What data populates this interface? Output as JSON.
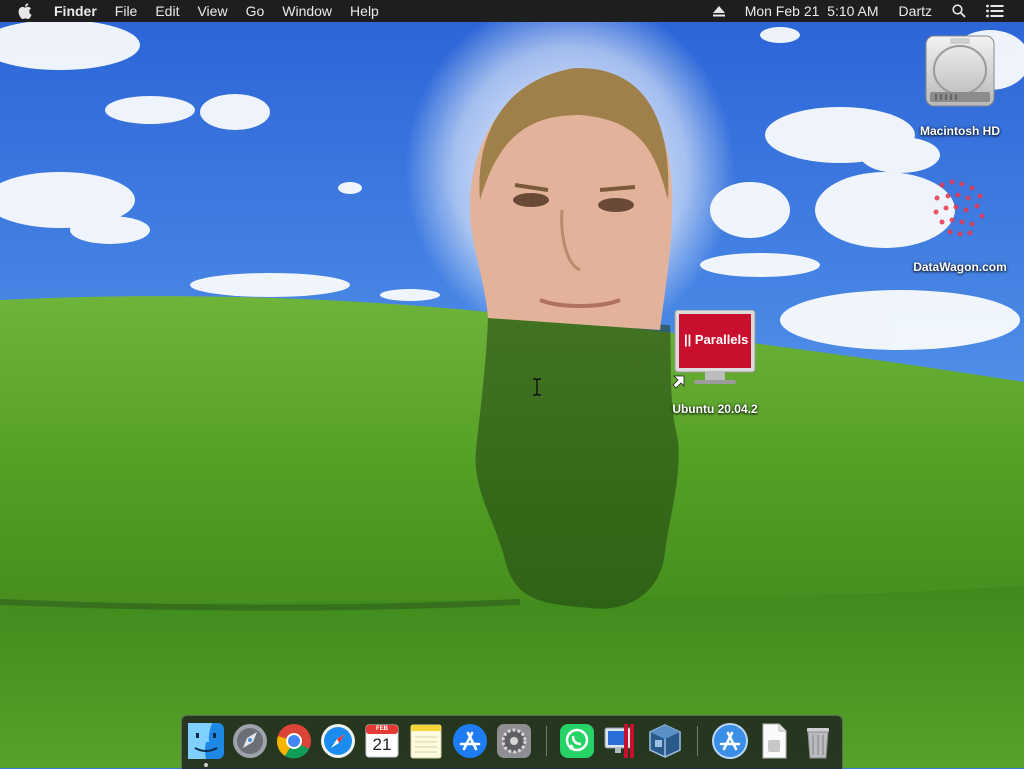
{
  "menubar": {
    "app_name": "Finder",
    "menus": [
      "File",
      "Edit",
      "View",
      "Go",
      "Window",
      "Help"
    ],
    "datetime": "Mon Feb 21  5:10 AM",
    "user": "Dartz"
  },
  "desktop": {
    "icons": [
      {
        "label": "Macintosh HD",
        "icon": "hard-drive-icon"
      },
      {
        "label": "DataWagon.com",
        "icon": "datawagon-icon"
      },
      {
        "label": "Ubuntu 20.04.2",
        "icon": "parallels-vm-icon"
      }
    ],
    "parallels_logo_text": "|| Parallels"
  },
  "dock": {
    "items": [
      {
        "name": "finder",
        "icon": "finder-icon",
        "running": true
      },
      {
        "name": "launchpad",
        "icon": "launchpad-icon"
      },
      {
        "name": "chrome",
        "icon": "chrome-icon"
      },
      {
        "name": "safari",
        "icon": "safari-icon"
      },
      {
        "name": "calendar",
        "icon": "calendar-icon"
      },
      {
        "name": "notes",
        "icon": "notes-icon"
      },
      {
        "name": "app-store",
        "icon": "app-store-icon"
      },
      {
        "name": "system-preferences",
        "icon": "gear-icon"
      },
      {
        "name": "whatsapp",
        "icon": "whatsapp-icon"
      },
      {
        "name": "parallels-desktop",
        "icon": "parallels-icon"
      },
      {
        "name": "virtualbox",
        "icon": "virtualbox-icon"
      },
      {
        "name": "applications-folder",
        "icon": "app-store-icon"
      },
      {
        "name": "document-stack",
        "icon": "document-icon"
      },
      {
        "name": "trash",
        "icon": "trash-icon"
      }
    ],
    "calendar_month": "FEB",
    "calendar_day": "21"
  },
  "colors": {
    "menubar_bg": "#1e1e1e",
    "sky_top": "#2f6fe0",
    "grass": "#4e9a26",
    "parallels_red": "#c8102e"
  }
}
